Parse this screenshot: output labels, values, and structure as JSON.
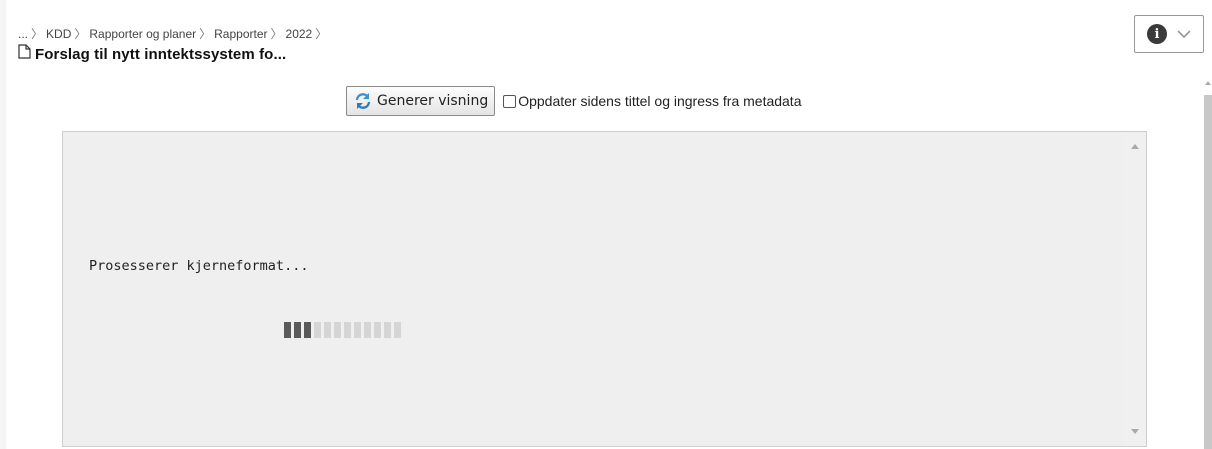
{
  "breadcrumb": {
    "items": [
      "...",
      "KDD",
      "Rapporter og planer",
      "Rapporter",
      "2022"
    ]
  },
  "page": {
    "title": "Forslag til nytt inntektssystem fo...",
    "title_icon": "document-icon"
  },
  "header": {
    "info_icon": "info-icon",
    "info_glyph": "i",
    "dropdown_icon": "chevron-down-icon"
  },
  "toolbar": {
    "generate_label": "Generer visning",
    "generate_icon": "refresh-icon",
    "update_checkbox_label": "Oppdater sidens tittel og ingress fra metadata",
    "update_checkbox_checked": false
  },
  "preview": {
    "status_text": "Prosesserer kjerneformat...",
    "progress": {
      "segments_total": 12,
      "segments_active": 3
    }
  },
  "colors": {
    "panel_bg": "#efefef",
    "active_segment": "#5a5a5a",
    "inactive_segment": "#d5d5d5",
    "refresh_icon": "#3a8fd6"
  }
}
